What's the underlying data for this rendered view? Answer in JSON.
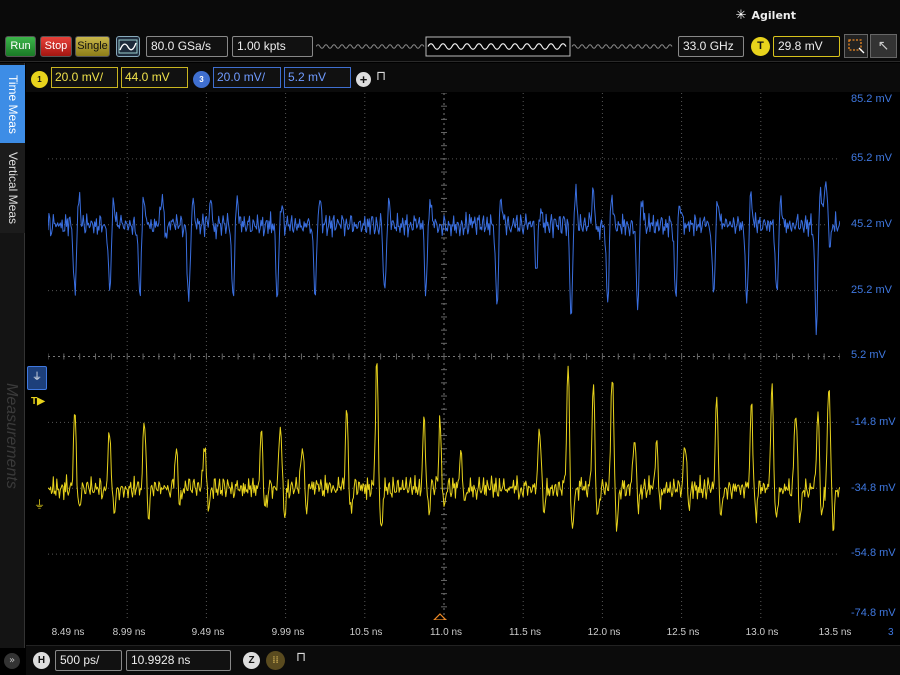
{
  "brand": {
    "name": "Agilent"
  },
  "toolbar": {
    "run_label": "Run",
    "stop_label": "Stop",
    "single_label": "Single",
    "sample_rate": "80.0 GSa/s",
    "memory_depth": "1.00 kpts",
    "bandwidth": "33.0 GHz",
    "trigger_badge": "T",
    "trigger_level": "29.8 mV"
  },
  "channels": {
    "ch1": {
      "badge": "1",
      "scale": "20.0 mV/",
      "offset": "44.0 mV",
      "color": "#e8d31c"
    },
    "ch3": {
      "badge": "3",
      "scale": "20.0 mV/",
      "offset": "5.2 mV",
      "color": "#3f6fd0"
    }
  },
  "sidebar": {
    "tabs": [
      "Time Meas",
      "Vertical Meas"
    ],
    "measurements_label": "Measurements"
  },
  "timebase": {
    "badge": "H",
    "scale": "500 ps/",
    "delay": "10.9928 ns",
    "zoom_badge": "Z"
  },
  "corner_digit": "3",
  "chart_data": {
    "type": "line",
    "x_tick_labels": [
      "8.49 ns",
      "8.99 ns",
      "9.49 ns",
      "9.99 ns",
      "10.5 ns",
      "11.0 ns",
      "11.5 ns",
      "12.0 ns",
      "12.5 ns",
      "13.0 ns",
      "13.5 ns"
    ],
    "y_tick_labels": [
      "85.2 mV",
      "65.2 mV",
      "45.2 mV",
      "25.2 mV",
      "5.2 mV",
      "-14.8 mV",
      "-34.8 mV",
      "-54.8 mV",
      "-74.8 mV"
    ],
    "xlim": [
      8.49,
      13.5
    ],
    "ylim": [
      -74.8,
      85.2
    ],
    "grid": true,
    "series": [
      {
        "channel": "3",
        "color": "#3a6fe0",
        "baseline_mV": 45.2,
        "noise_mV": 4.5,
        "spikes": [
          [
            8.66,
            -22
          ],
          [
            8.88,
            -19
          ],
          [
            9.07,
            -21
          ],
          [
            9.21,
            9
          ],
          [
            9.38,
            -24
          ],
          [
            9.52,
            7
          ],
          [
            9.66,
            -22
          ],
          [
            9.94,
            -22
          ],
          [
            10.18,
            -22
          ],
          [
            10.62,
            -21
          ],
          [
            10.88,
            -21
          ],
          [
            11.33,
            -24
          ],
          [
            11.58,
            -14
          ],
          [
            11.8,
            -30
          ],
          [
            11.94,
            10
          ],
          [
            12.03,
            -24
          ],
          [
            12.22,
            -24
          ],
          [
            12.46,
            -22
          ],
          [
            12.7,
            -22
          ],
          [
            12.91,
            -24
          ],
          [
            13.1,
            -21
          ],
          [
            13.35,
            -32
          ],
          [
            13.41,
            14
          ]
        ]
      },
      {
        "channel": "1",
        "color": "#e8d31c",
        "baseline_mV": -34.8,
        "noise_mV": 4.5,
        "spikes": [
          [
            8.66,
            22
          ],
          [
            8.88,
            18
          ],
          [
            9.1,
            21
          ],
          [
            9.3,
            12
          ],
          [
            9.48,
            14
          ],
          [
            9.84,
            17
          ],
          [
            9.96,
            20
          ],
          [
            10.1,
            14
          ],
          [
            10.38,
            23
          ],
          [
            10.57,
            39
          ],
          [
            10.87,
            21
          ],
          [
            10.97,
            20
          ],
          [
            11.1,
            12
          ],
          [
            11.6,
            18
          ],
          [
            11.78,
            37
          ],
          [
            11.94,
            32
          ],
          [
            12.06,
            36
          ],
          [
            12.2,
            16
          ],
          [
            12.34,
            14
          ],
          [
            12.52,
            15
          ],
          [
            12.72,
            27
          ],
          [
            12.94,
            26
          ],
          [
            13.07,
            32
          ],
          [
            13.22,
            25
          ],
          [
            13.36,
            22
          ],
          [
            13.43,
            33
          ]
        ]
      }
    ]
  }
}
